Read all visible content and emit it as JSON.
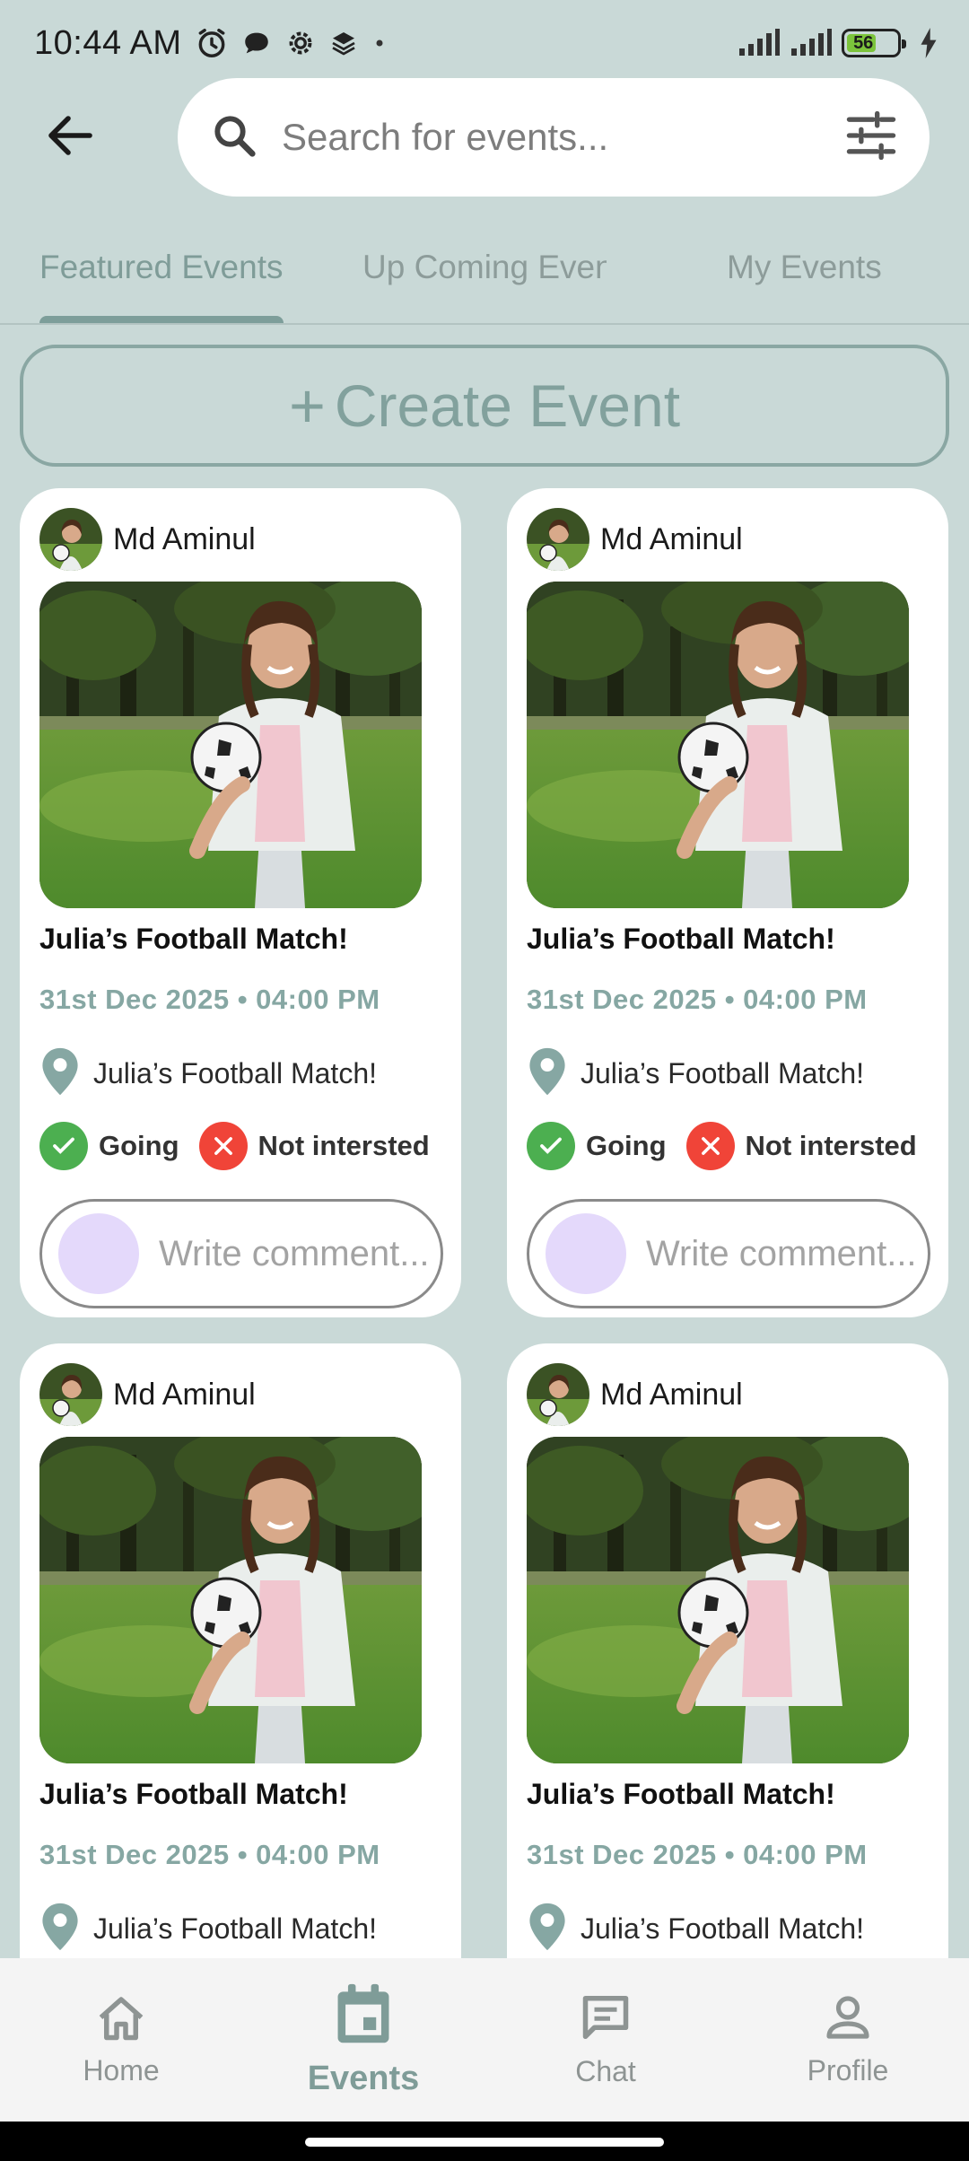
{
  "status_bar": {
    "time": "10:44 AM",
    "battery": "56",
    "icons": [
      "alarm-icon",
      "chat-bubble-icon",
      "settings-icon",
      "stack-icon",
      "dot-icon",
      "signal-icon",
      "signal-icon",
      "battery-icon",
      "charging-icon"
    ]
  },
  "search": {
    "placeholder": "Search for events..."
  },
  "tabs": [
    {
      "label": "Featured Events",
      "active": true
    },
    {
      "label": "Up Coming Events",
      "active": false
    },
    {
      "label": "My Events",
      "active": false
    }
  ],
  "create_event": {
    "plus": "+",
    "label": "Create Event"
  },
  "cards": [
    {
      "author": "Md Aminul",
      "title": "Julia’s Football Match!",
      "date": "31st Dec 2025 • 04:00 PM",
      "location": "Julia’s Football Match!",
      "going_label": "Going",
      "not_interested_label": "Not intersted",
      "comment_placeholder": "Write comment..."
    },
    {
      "author": "Md Aminul",
      "title": "Julia’s Football Match!",
      "date": "31st Dec 2025 • 04:00 PM",
      "location": "Julia’s Football Match!",
      "going_label": "Going",
      "not_interested_label": "Not intersted",
      "comment_placeholder": "Write comment..."
    },
    {
      "author": "Md Aminul",
      "title": "Julia’s Football Match!",
      "date": "31st Dec 2025 • 04:00 PM",
      "location": "Julia’s Football Match!"
    },
    {
      "author": "Md Aminul",
      "title": "Julia’s Football Match!",
      "date": "31st Dec 2025 • 04:00 PM",
      "location": "Julia’s Football Match!"
    }
  ],
  "bottom_nav": [
    {
      "label": "Home",
      "icon": "home-icon",
      "active": false
    },
    {
      "label": "Events",
      "icon": "calendar-icon",
      "active": true
    },
    {
      "label": "Chat",
      "icon": "chat-icon",
      "active": false
    },
    {
      "label": "Profile",
      "icon": "profile-icon",
      "active": false
    }
  ],
  "colors": {
    "background": "#c9d9d7",
    "accent": "#7f9c98",
    "going": "#4caf50",
    "not_interested": "#f04438",
    "comment_avatar": "#e4d9fb"
  }
}
